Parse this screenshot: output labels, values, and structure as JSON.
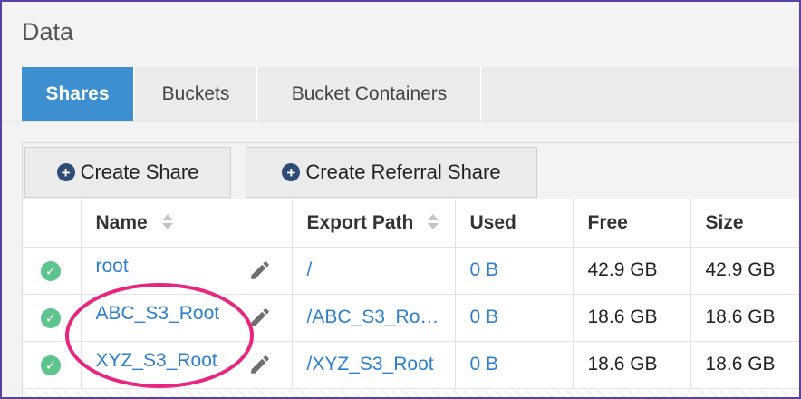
{
  "page": {
    "title": "Data"
  },
  "tabs": [
    {
      "label": "Shares",
      "active": true
    },
    {
      "label": "Buckets",
      "active": false
    },
    {
      "label": "Bucket Containers",
      "active": false
    }
  ],
  "toolbar": {
    "create_share_label": "Create Share",
    "create_referral_share_label": "Create Referral Share",
    "plus_icon": "plus-circle-icon"
  },
  "table": {
    "columns": [
      "",
      "Name",
      "Export Path",
      "Used",
      "Free",
      "Size"
    ],
    "rows": [
      {
        "status_icon": "check-circle-icon",
        "name": "root",
        "export_path": "/",
        "used": "0 B",
        "free": "42.9 GB",
        "size": "42.9 GB"
      },
      {
        "status_icon": "check-circle-icon",
        "name": "ABC_S3_Root",
        "export_path": "/ABC_S3_Ro…",
        "used": "0 B",
        "free": "18.6 GB",
        "size": "18.6 GB"
      },
      {
        "status_icon": "check-circle-icon",
        "name": "XYZ_S3_Root",
        "export_path": "/XYZ_S3_Root",
        "used": "0 B",
        "free": "18.6 GB",
        "size": "18.6 GB"
      }
    ]
  },
  "colors": {
    "active_tab": "#3d8fcf",
    "link": "#2b7fd0",
    "status_ok": "#5cc48d",
    "highlight": "#e8257f",
    "frame": "#5b3fa8"
  }
}
